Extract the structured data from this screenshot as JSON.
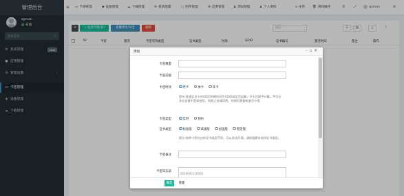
{
  "sidebar": {
    "brand": "管理后台",
    "user_name": "qyman",
    "user_status": "在线",
    "search_placeholder": "搜索菜单",
    "items": [
      {
        "label": "系统管理",
        "icon": "gears-icon",
        "badge": "new"
      },
      {
        "label": "应用管理",
        "icon": "circle-icon"
      },
      {
        "label": "管理设置",
        "icon": "list-icon"
      },
      {
        "label": "卡密管理",
        "icon": "card-icon"
      },
      {
        "label": "设备管理",
        "icon": "wifi-icon"
      },
      {
        "label": "下载管理",
        "icon": "cloud-icon"
      }
    ]
  },
  "topbar": {
    "items": [
      {
        "label": "卡密管理",
        "icon": "card-icon"
      },
      {
        "label": "设备管理",
        "icon": "device-icon"
      },
      {
        "label": "下载管理",
        "icon": "cloud-icon"
      },
      {
        "label": "系统配置",
        "icon": "gear-icon"
      },
      {
        "label": "附件管理",
        "icon": "file-icon"
      },
      {
        "label": "应用管理",
        "icon": "circle-icon"
      },
      {
        "label": "添加管理",
        "icon": "user-plus-icon"
      },
      {
        "label": "个人资料",
        "icon": "person-icon"
      },
      {
        "label": "主页",
        "icon": "home-icon"
      },
      {
        "label": "清除缓存",
        "icon": "trash-icon"
      }
    ],
    "right_user": "qyman"
  },
  "toolbar": {
    "add_label": "+ 生成卡密(多)",
    "edit_label": "批量修改/导出",
    "delete_label": "删除",
    "search_placeholder": "搜索"
  },
  "table": {
    "headers": [
      "ID",
      "卡密",
      "激活",
      "卡密有效类型",
      "证书类型",
      "时效",
      "UDID",
      "证书编号",
      "激活时间",
      "备注",
      "操作"
    ]
  },
  "modal": {
    "title": "添加",
    "fields": {
      "card_count": "卡密数量",
      "card_prefix": "卡密前缀",
      "card_length": "卡密时效",
      "card_type": "卡密类型",
      "cert_type": "证书类型",
      "card_remark": "卡密备注",
      "card_records": "卡密日志录"
    },
    "length_options": [
      "月卡",
      "季卡",
      "年卡"
    ],
    "length_help": "提示:普通会员卡的UDID到期时间为UDID绑定后起算，开卡日期不计算。不可在多台设备中登录使用，到期之前请续费，到期后需重新激活卡密。",
    "type_options": [
      "实时",
      "预约"
    ],
    "cert_options": [
      "标准版",
      "高级版",
      "加强版",
      "稳定版"
    ],
    "cert_help": "提示:每种卡密对应的证书类型不同，可以多选开通，请根据需求选择证书类型。",
    "records_value": "2019092116000",
    "ok_label": "确定",
    "reset_label": "重置"
  },
  "colors": {
    "sidebar_bg": "#222d32",
    "brand_bg": "#2f3a40",
    "btn_success": "#18bc9c",
    "btn_edit": "#3c8dbc",
    "btn_danger": "#e74c3c",
    "btn_dark": "#444c54"
  }
}
